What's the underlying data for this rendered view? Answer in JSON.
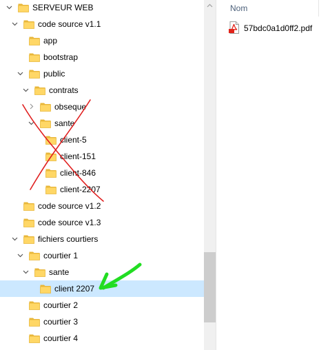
{
  "tree": {
    "items": [
      {
        "label": "SERVEUR WEB",
        "depth": 1,
        "expanded": true
      },
      {
        "label": "code source v1.1",
        "depth": 2,
        "expanded": true
      },
      {
        "label": "app",
        "depth": 3
      },
      {
        "label": "bootstrap",
        "depth": 3
      },
      {
        "label": "public",
        "depth": 3,
        "expanded": true
      },
      {
        "label": "contrats",
        "depth": 4,
        "expanded": true
      },
      {
        "label": "obseque",
        "depth": 5,
        "expanded": false
      },
      {
        "label": "sante",
        "depth": 5,
        "expanded": true
      },
      {
        "label": "client-5",
        "depth": 6
      },
      {
        "label": "client-151",
        "depth": 6
      },
      {
        "label": "client-846",
        "depth": 6
      },
      {
        "label": "client-2207",
        "depth": 6
      },
      {
        "label": "code source v1.2",
        "depth": 2
      },
      {
        "label": "code source v1.3",
        "depth": 2
      },
      {
        "label": "fichiers courtiers",
        "depth": 2,
        "expanded": true
      },
      {
        "label": "courtier 1",
        "depth": 3,
        "expanded": true
      },
      {
        "label": "sante",
        "depth": 4,
        "expanded": true
      },
      {
        "label": "client 2207",
        "depth": 5,
        "selected": true
      },
      {
        "label": "courtier 2",
        "depth": 3
      },
      {
        "label": "courtier 3",
        "depth": 3
      },
      {
        "label": "courtier 4",
        "depth": 3
      }
    ]
  },
  "content": {
    "column_name": "Nom",
    "files": [
      {
        "name": "57bdc0a1d0ff2.pdf",
        "icon": "pdf-file-icon"
      }
    ]
  },
  "annotations": {
    "cross_color": "#e02020",
    "arrow_color": "#22dd22"
  },
  "colors": {
    "folder": "#ffd766",
    "folder_dark": "#e8b73a",
    "selection": "#cce8ff"
  }
}
